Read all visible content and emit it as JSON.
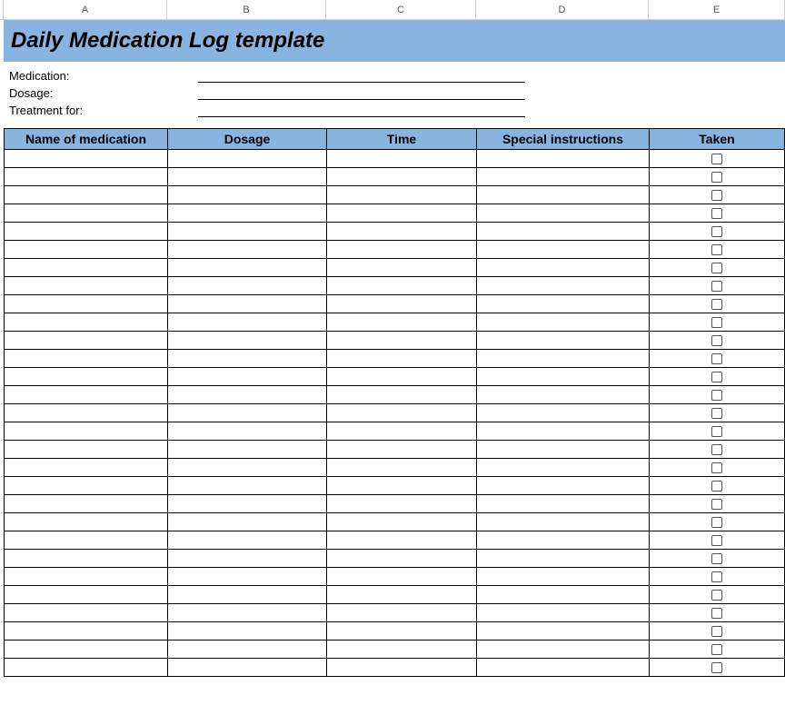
{
  "columns": {
    "a": "A",
    "b": "B",
    "c": "C",
    "d": "D",
    "e": "E"
  },
  "title": "Daily Medication Log template",
  "meta": {
    "medication_label": "Medication:",
    "dosage_label": "Dosage:",
    "treatment_label": "Treatment for:",
    "medication_value": "",
    "dosage_value": "",
    "treatment_value": ""
  },
  "headers": {
    "name": "Name of medication",
    "dosage": "Dosage",
    "time": "Time",
    "special": "Special instructions",
    "taken": "Taken"
  },
  "rows": [
    {
      "name": "",
      "dosage": "",
      "time": "",
      "special": "",
      "taken": false
    },
    {
      "name": "",
      "dosage": "",
      "time": "",
      "special": "",
      "taken": false
    },
    {
      "name": "",
      "dosage": "",
      "time": "",
      "special": "",
      "taken": false
    },
    {
      "name": "",
      "dosage": "",
      "time": "",
      "special": "",
      "taken": false
    },
    {
      "name": "",
      "dosage": "",
      "time": "",
      "special": "",
      "taken": false
    },
    {
      "name": "",
      "dosage": "",
      "time": "",
      "special": "",
      "taken": false
    },
    {
      "name": "",
      "dosage": "",
      "time": "",
      "special": "",
      "taken": false
    },
    {
      "name": "",
      "dosage": "",
      "time": "",
      "special": "",
      "taken": false
    },
    {
      "name": "",
      "dosage": "",
      "time": "",
      "special": "",
      "taken": false
    },
    {
      "name": "",
      "dosage": "",
      "time": "",
      "special": "",
      "taken": false
    },
    {
      "name": "",
      "dosage": "",
      "time": "",
      "special": "",
      "taken": false
    },
    {
      "name": "",
      "dosage": "",
      "time": "",
      "special": "",
      "taken": false
    },
    {
      "name": "",
      "dosage": "",
      "time": "",
      "special": "",
      "taken": false
    },
    {
      "name": "",
      "dosage": "",
      "time": "",
      "special": "",
      "taken": false
    },
    {
      "name": "",
      "dosage": "",
      "time": "",
      "special": "",
      "taken": false
    },
    {
      "name": "",
      "dosage": "",
      "time": "",
      "special": "",
      "taken": false
    },
    {
      "name": "",
      "dosage": "",
      "time": "",
      "special": "",
      "taken": false
    },
    {
      "name": "",
      "dosage": "",
      "time": "",
      "special": "",
      "taken": false
    },
    {
      "name": "",
      "dosage": "",
      "time": "",
      "special": "",
      "taken": false
    },
    {
      "name": "",
      "dosage": "",
      "time": "",
      "special": "",
      "taken": false
    },
    {
      "name": "",
      "dosage": "",
      "time": "",
      "special": "",
      "taken": false
    },
    {
      "name": "",
      "dosage": "",
      "time": "",
      "special": "",
      "taken": false
    },
    {
      "name": "",
      "dosage": "",
      "time": "",
      "special": "",
      "taken": false
    },
    {
      "name": "",
      "dosage": "",
      "time": "",
      "special": "",
      "taken": false
    },
    {
      "name": "",
      "dosage": "",
      "time": "",
      "special": "",
      "taken": false
    },
    {
      "name": "",
      "dosage": "",
      "time": "",
      "special": "",
      "taken": false
    },
    {
      "name": "",
      "dosage": "",
      "time": "",
      "special": "",
      "taken": false
    },
    {
      "name": "",
      "dosage": "",
      "time": "",
      "special": "",
      "taken": false
    },
    {
      "name": "",
      "dosage": "",
      "time": "",
      "special": "",
      "taken": false
    }
  ]
}
